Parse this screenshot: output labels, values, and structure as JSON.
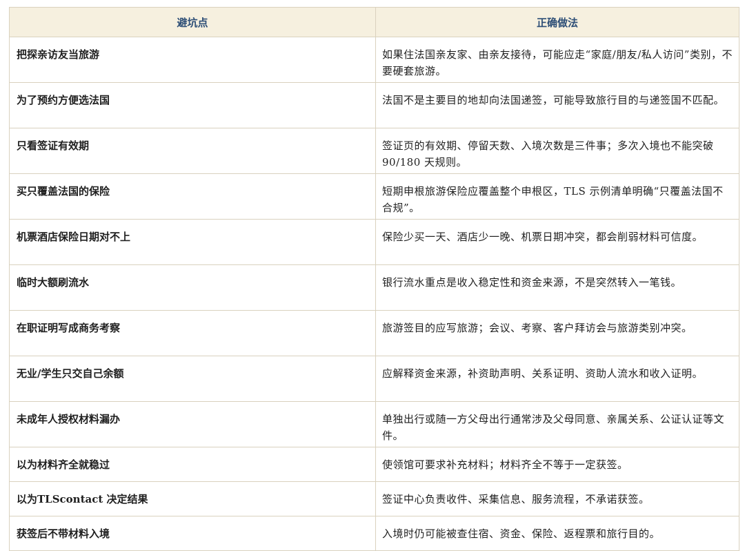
{
  "table": {
    "headers": [
      "避坑点",
      "正确做法"
    ],
    "rows": [
      {
        "pitfall": "把探亲访友当旅游",
        "correct": "如果住法国亲友家、由亲友接待，可能应走“家庭/朋友/私人访问”类别，不要硬套旅游。"
      },
      {
        "pitfall": "为了预约方便选法国",
        "correct": "法国不是主要目的地却向法国递签，可能导致旅行目的与递签国不匹配。"
      },
      {
        "pitfall": "只看签证有效期",
        "correct": "签证页的有效期、停留天数、入境次数是三件事；多次入境也不能突破90/180 天规则。"
      },
      {
        "pitfall": "买只覆盖法国的保险",
        "correct": "短期申根旅游保险应覆盖整个申根区，TLS 示例清单明确“只覆盖法国不合规”。"
      },
      {
        "pitfall": "机票酒店保险日期对不上",
        "correct": "保险少买一天、酒店少一晚、机票日期冲突，都会削弱材料可信度。"
      },
      {
        "pitfall": "临时大额刷流水",
        "correct": "银行流水重点是收入稳定性和资金来源，不是突然转入一笔钱。"
      },
      {
        "pitfall": "在职证明写成商务考察",
        "correct": "旅游签目的应写旅游；会议、考察、客户拜访会与旅游类别冲突。"
      },
      {
        "pitfall": "无业/学生只交自己余额",
        "correct": "应解释资金来源，补资助声明、关系证明、资助人流水和收入证明。"
      },
      {
        "pitfall": "未成年人授权材料漏办",
        "correct": "单独出行或随一方父母出行通常涉及父母同意、亲属关系、公证认证等文件。"
      },
      {
        "pitfall": "以为材料齐全就稳过",
        "correct": "使领馆可要求补充材料；材料齐全不等于一定获签。"
      },
      {
        "pitfall": "以为TLScontact 决定结果",
        "correct": "签证中心负责收件、采集信息、服务流程，不承诺获签。"
      },
      {
        "pitfall": "获签后不带材料入境",
        "correct": "入境时仍可能被查住宿、资金、保险、返程票和旅行目的。"
      }
    ]
  },
  "colors": {
    "header_bg": "#f6f0df",
    "header_text": "#2d4e76",
    "border": "#d9d1be"
  }
}
